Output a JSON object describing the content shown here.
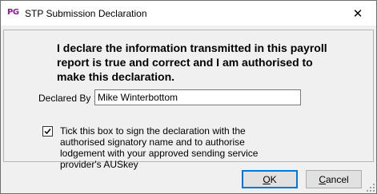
{
  "window": {
    "app_icon_text": "PG",
    "title": "STP Submission Declaration",
    "close_symbol": "✕"
  },
  "declaration_text": "I declare the information transmitted in this payroll report is true and correct and I am authorised to make this declaration.",
  "declared_by": {
    "label": "Declared By :",
    "value": "Mike Winterbottom"
  },
  "consent": {
    "checked": true,
    "text": "Tick this box to sign the declaration with the authorised signatory name and to authorise lodgement with your approved sending service provider's AUSkey"
  },
  "buttons": {
    "ok_accel": "O",
    "ok_rest": "K",
    "cancel_accel": "C",
    "cancel_rest": "ancel"
  },
  "colors": {
    "app_icon": "#8a1c8f",
    "default_button_border": "#0078d7",
    "dialog_background": "#f0f0f0"
  },
  "icons": {
    "app": "pg-app-icon",
    "close": "close-icon",
    "checkbox": "checkmark-icon",
    "resize": "resize-grip-icon"
  }
}
